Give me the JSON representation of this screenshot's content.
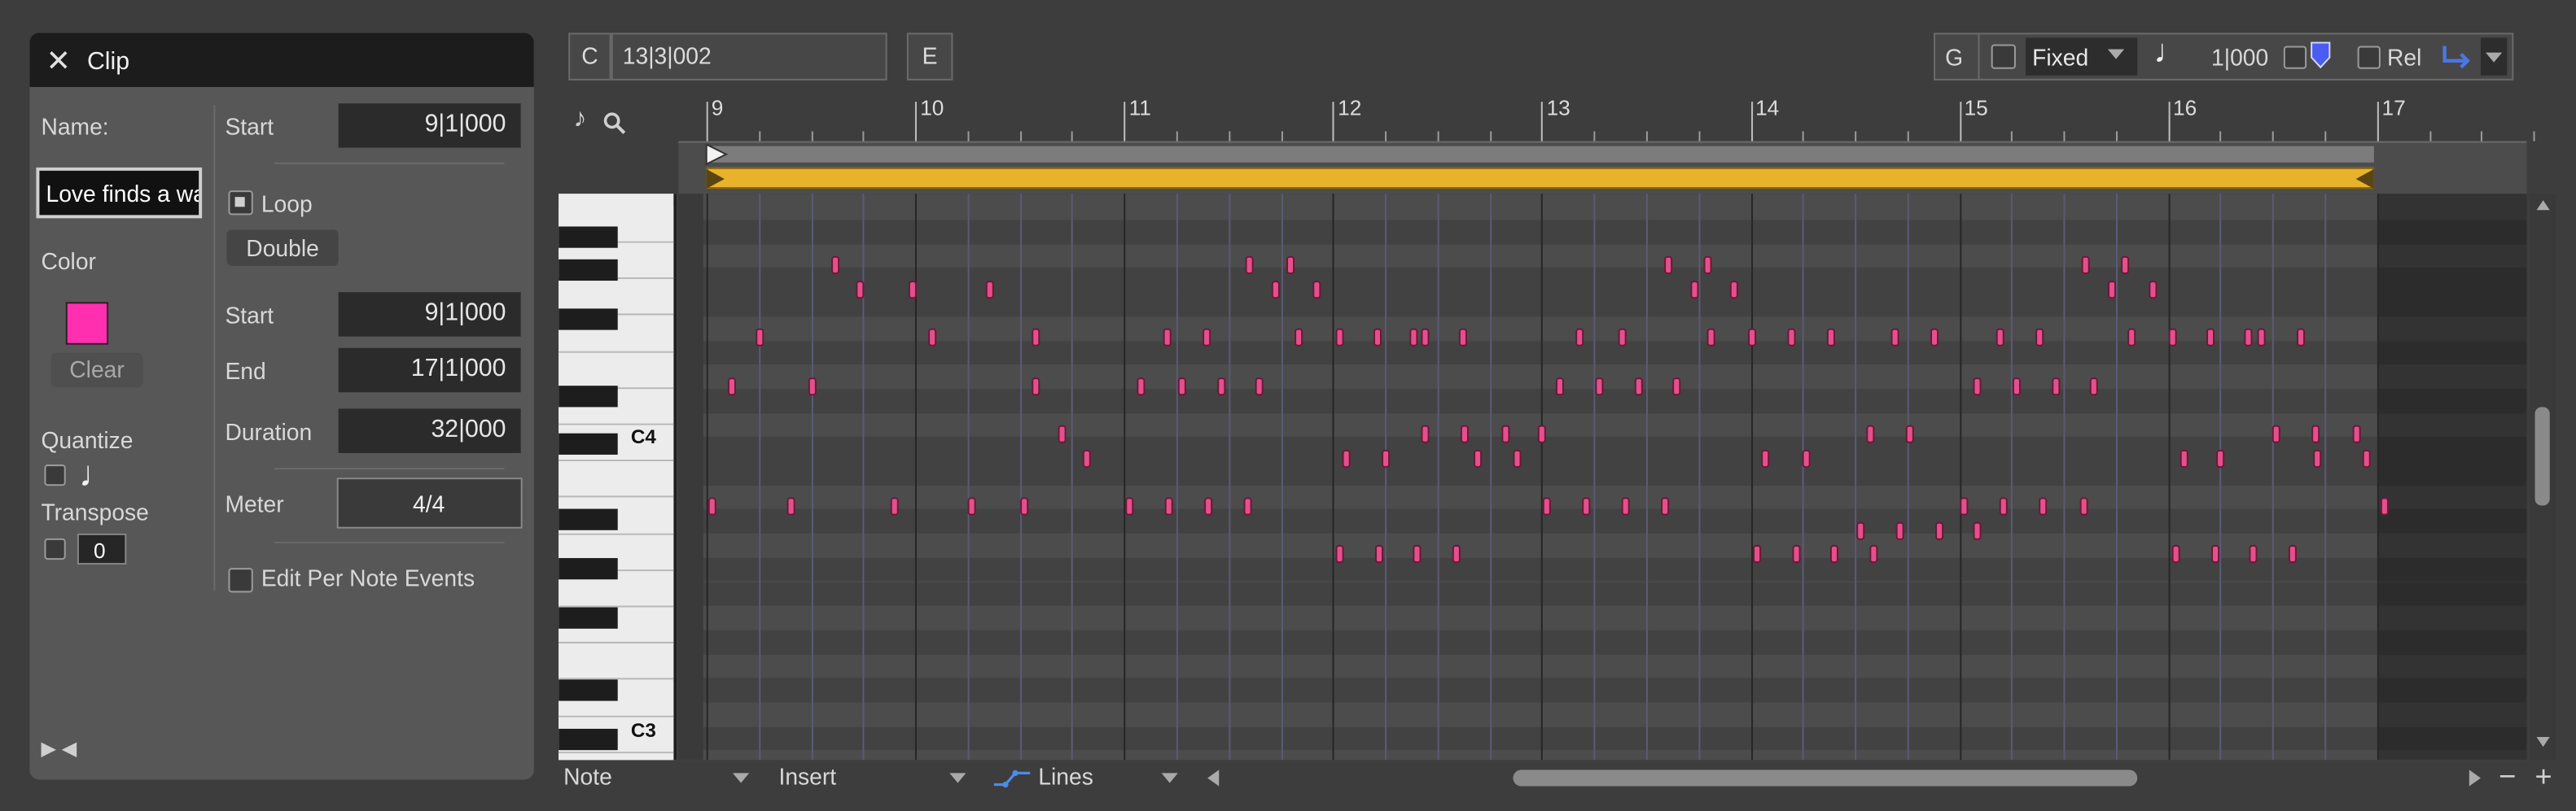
{
  "clip_panel": {
    "title": "Clip",
    "close_icon": "close-icon",
    "name_label": "Name:",
    "name_value": "Love finds a wa",
    "color_label": "Color",
    "color_swatch": "#ff2fb0",
    "clear_label": "Clear",
    "quantize_label": "Quantize",
    "quantize_note_icon": "quarter-note-icon",
    "transpose_label": "Transpose",
    "transpose_value": "0",
    "start_label": "Start",
    "start_value": "9|1|000",
    "loop_label": "Loop",
    "double_label": "Double",
    "loop_start_label": "Start",
    "loop_start_value": "9|1|000",
    "end_label": "End",
    "end_value": "17|1|000",
    "duration_label": "Duration",
    "duration_value": "32|000",
    "meter_label": "Meter",
    "meter_value": "4/4",
    "edit_per_note_label": "Edit Per Note Events",
    "collapse_icons": "play-left-arrows-icon"
  },
  "toolbar": {
    "c_label": "C",
    "position_value": "13|3|002",
    "e_label": "E",
    "g_label": "G",
    "fixed_label": "Fixed",
    "grid_value": "1|000",
    "rel_label": "Rel"
  },
  "ruler": {
    "bars": [
      "9",
      "10",
      "11",
      "12",
      "13",
      "14",
      "15",
      "16",
      "17"
    ]
  },
  "piano": {
    "c4_label": "C4",
    "c3_label": "C3"
  },
  "bottom_bar": {
    "note_label": "Note",
    "insert_label": "Insert",
    "lines_label": "Lines"
  },
  "colors": {
    "note_fill": "#e3508c",
    "loop_bar": "#e8b22a",
    "panel_bg": "#575757",
    "title_bar": "#1c1c1c"
  },
  "chart_data": {
    "type": "scatter",
    "title": "",
    "xlabel": "",
    "ylabel": "",
    "x_unit": "bar",
    "y_unit": "pitch (C3..C4 region)",
    "xlim": [
      9,
      17
    ],
    "notes": [
      {
        "bar": 9.61,
        "row": 2
      },
      {
        "bar": 9.73,
        "row": 3
      },
      {
        "bar": 9.98,
        "row": 3
      },
      {
        "bar": 10.35,
        "row": 3
      },
      {
        "bar": 11.6,
        "row": 2
      },
      {
        "bar": 11.72,
        "row": 3
      },
      {
        "bar": 11.79,
        "row": 2
      },
      {
        "bar": 11.92,
        "row": 3
      },
      {
        "bar": 13.6,
        "row": 2
      },
      {
        "bar": 13.73,
        "row": 3
      },
      {
        "bar": 13.79,
        "row": 2
      },
      {
        "bar": 13.92,
        "row": 3
      },
      {
        "bar": 15.6,
        "row": 2
      },
      {
        "bar": 15.73,
        "row": 3
      },
      {
        "bar": 15.79,
        "row": 2
      },
      {
        "bar": 15.92,
        "row": 3
      },
      {
        "bar": 9.25,
        "row": 5
      },
      {
        "bar": 10.08,
        "row": 5
      },
      {
        "bar": 10.57,
        "row": 5
      },
      {
        "bar": 11.2,
        "row": 5
      },
      {
        "bar": 11.39,
        "row": 5
      },
      {
        "bar": 11.83,
        "row": 5
      },
      {
        "bar": 12.03,
        "row": 5
      },
      {
        "bar": 12.21,
        "row": 5
      },
      {
        "bar": 12.38,
        "row": 5
      },
      {
        "bar": 12.44,
        "row": 5
      },
      {
        "bar": 12.62,
        "row": 5
      },
      {
        "bar": 13.18,
        "row": 5
      },
      {
        "bar": 13.38,
        "row": 5
      },
      {
        "bar": 13.81,
        "row": 5
      },
      {
        "bar": 14.0,
        "row": 5
      },
      {
        "bar": 14.19,
        "row": 5
      },
      {
        "bar": 14.38,
        "row": 5
      },
      {
        "bar": 14.69,
        "row": 5
      },
      {
        "bar": 14.88,
        "row": 5
      },
      {
        "bar": 15.19,
        "row": 5
      },
      {
        "bar": 15.38,
        "row": 5
      },
      {
        "bar": 15.82,
        "row": 5
      },
      {
        "bar": 16.02,
        "row": 5
      },
      {
        "bar": 16.2,
        "row": 5
      },
      {
        "bar": 16.38,
        "row": 5
      },
      {
        "bar": 16.44,
        "row": 5
      },
      {
        "bar": 16.63,
        "row": 5
      },
      {
        "bar": 9.12,
        "row": 7
      },
      {
        "bar": 9.5,
        "row": 7
      },
      {
        "bar": 10.57,
        "row": 7
      },
      {
        "bar": 11.08,
        "row": 7
      },
      {
        "bar": 11.27,
        "row": 7
      },
      {
        "bar": 11.46,
        "row": 7
      },
      {
        "bar": 11.64,
        "row": 7
      },
      {
        "bar": 13.08,
        "row": 7
      },
      {
        "bar": 13.27,
        "row": 7
      },
      {
        "bar": 13.46,
        "row": 7
      },
      {
        "bar": 13.64,
        "row": 7
      },
      {
        "bar": 15.08,
        "row": 7
      },
      {
        "bar": 15.27,
        "row": 7
      },
      {
        "bar": 15.46,
        "row": 7
      },
      {
        "bar": 15.64,
        "row": 7
      },
      {
        "bar": 10.7,
        "row": 9
      },
      {
        "bar": 12.44,
        "row": 9
      },
      {
        "bar": 12.63,
        "row": 9
      },
      {
        "bar": 12.82,
        "row": 9
      },
      {
        "bar": 13.0,
        "row": 9
      },
      {
        "bar": 14.57,
        "row": 9
      },
      {
        "bar": 14.76,
        "row": 9
      },
      {
        "bar": 16.51,
        "row": 9
      },
      {
        "bar": 16.7,
        "row": 9
      },
      {
        "bar": 16.9,
        "row": 9
      },
      {
        "bar": 10.82,
        "row": 10
      },
      {
        "bar": 12.06,
        "row": 10
      },
      {
        "bar": 12.25,
        "row": 10
      },
      {
        "bar": 12.69,
        "row": 10
      },
      {
        "bar": 12.88,
        "row": 10
      },
      {
        "bar": 14.07,
        "row": 10
      },
      {
        "bar": 14.26,
        "row": 10
      },
      {
        "bar": 16.07,
        "row": 10
      },
      {
        "bar": 16.25,
        "row": 10
      },
      {
        "bar": 16.71,
        "row": 10
      },
      {
        "bar": 16.95,
        "row": 10
      },
      {
        "bar": 9.02,
        "row": 12
      },
      {
        "bar": 9.4,
        "row": 12
      },
      {
        "bar": 9.9,
        "row": 12
      },
      {
        "bar": 10.27,
        "row": 12
      },
      {
        "bar": 10.52,
        "row": 12
      },
      {
        "bar": 11.02,
        "row": 12
      },
      {
        "bar": 11.21,
        "row": 12
      },
      {
        "bar": 11.4,
        "row": 12
      },
      {
        "bar": 11.59,
        "row": 12
      },
      {
        "bar": 13.02,
        "row": 12
      },
      {
        "bar": 13.21,
        "row": 12
      },
      {
        "bar": 13.4,
        "row": 12
      },
      {
        "bar": 13.59,
        "row": 12
      },
      {
        "bar": 15.02,
        "row": 12
      },
      {
        "bar": 15.21,
        "row": 12
      },
      {
        "bar": 15.4,
        "row": 12
      },
      {
        "bar": 15.59,
        "row": 12
      },
      {
        "bar": 17.03,
        "row": 12
      },
      {
        "bar": 14.52,
        "row": 13
      },
      {
        "bar": 14.71,
        "row": 13
      },
      {
        "bar": 14.9,
        "row": 13
      },
      {
        "bar": 15.08,
        "row": 13
      },
      {
        "bar": 12.03,
        "row": 14
      },
      {
        "bar": 12.22,
        "row": 14
      },
      {
        "bar": 12.4,
        "row": 14
      },
      {
        "bar": 12.59,
        "row": 14
      },
      {
        "bar": 14.03,
        "row": 14
      },
      {
        "bar": 14.22,
        "row": 14
      },
      {
        "bar": 14.4,
        "row": 14
      },
      {
        "bar": 14.59,
        "row": 14
      },
      {
        "bar": 16.03,
        "row": 14
      },
      {
        "bar": 16.22,
        "row": 14
      },
      {
        "bar": 16.4,
        "row": 14
      },
      {
        "bar": 16.59,
        "row": 14
      }
    ]
  }
}
